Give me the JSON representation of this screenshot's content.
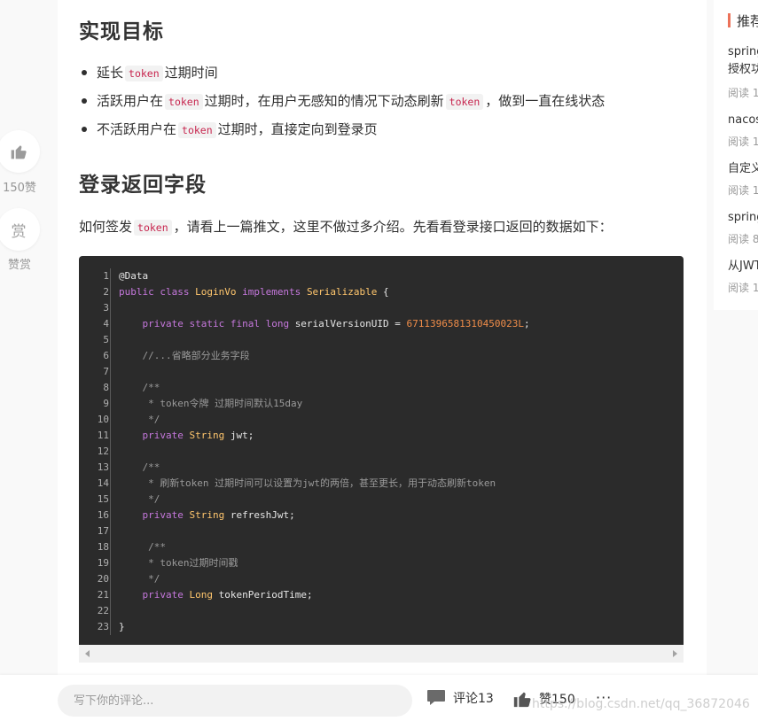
{
  "rail": {
    "like_count_label": "150赞",
    "reward_icon_text": "赏",
    "reward_label": "赞赏"
  },
  "article": {
    "section1_heading": "实现目标",
    "bullets": [
      {
        "pre": "延长",
        "code": "token",
        "post": "过期时间"
      },
      {
        "pre": "活跃用户在",
        "code": "token",
        "mid": "过期时，在用户无感知的情况下动态刷新",
        "code2": "token",
        "post": "，做到一直在线状态"
      },
      {
        "pre": "不活跃用户在",
        "code": "token",
        "post": "过期时，直接定向到登录页"
      }
    ],
    "section2_heading": "登录返回字段",
    "para": {
      "pre": "如何签发",
      "code": "token",
      "post": "，请看上一篇推文，这里不做过多介绍。先看看登录接口返回的数据如下："
    }
  },
  "code_block": {
    "line_numbers": [
      "1",
      "2",
      "3",
      "4",
      "5",
      "6",
      "7",
      "8",
      "9",
      "10",
      "11",
      "12",
      "13",
      "14",
      "15",
      "16",
      "17",
      "18",
      "19",
      "20",
      "21",
      "22",
      "23"
    ],
    "lines": {
      "l1": "@Data",
      "l2_kw1": "public class ",
      "l2_cls": "LoginVo ",
      "l2_kw2": "implements ",
      "l2_iface": "Serializable",
      "l2_end": " {",
      "l4_kw": "private static final long ",
      "l4_name": "serialVersionUID = ",
      "l4_num": "6711396581310450023L",
      "l4_end": ";",
      "l6": "//...省略部分业务字段",
      "l8": "/**",
      "l9": " * token令牌 过期时间默认15day",
      "l10": " */",
      "l11_kw": "private ",
      "l11_type": "String ",
      "l11_name": "jwt;",
      "l13": "/**",
      "l14": " * 刷新token 过期时间可以设置为jwt的两倍，甚至更长，用于动态刷新token",
      "l15": " */",
      "l16_kw": "private ",
      "l16_type": "String ",
      "l16_name": "refreshJwt;",
      "l18": " /**",
      "l19": " * token过期时间戳",
      "l20": " */",
      "l21_kw": "private ",
      "l21_type": "Long ",
      "l21_name": "tokenPeriodTime;",
      "l23": "}"
    }
  },
  "sidebar": {
    "title": "推荐",
    "items": [
      {
        "title": "spring",
        "title2": "授权功",
        "meta": "阅读 1,"
      },
      {
        "title": "nacos",
        "meta": "阅读 1!"
      },
      {
        "title": "自定义",
        "meta": "阅读 1("
      },
      {
        "title": "spring",
        "meta": "阅读 8"
      },
      {
        "title": "从JWT",
        "meta": "阅读 1("
      }
    ]
  },
  "bottombar": {
    "comment_placeholder": "写下你的评论...",
    "comment_count_label": "评论13",
    "like_label": "赞150",
    "watermark": "https://blog.csdn.net/qq_36872046",
    "more_label": "···"
  },
  "colors": {
    "accent": "#ec7259",
    "code_bg": "#2b2b2b",
    "inline_code": "#c7254e"
  }
}
